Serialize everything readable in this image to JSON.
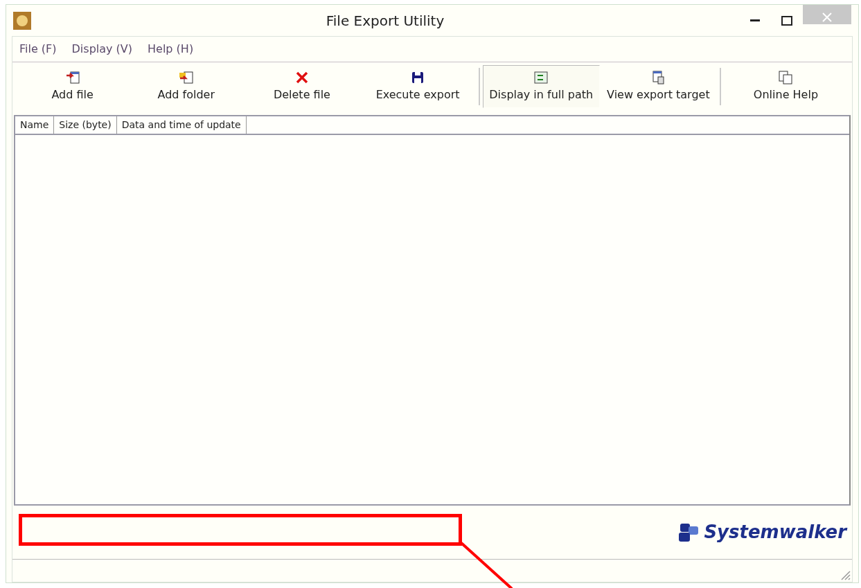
{
  "window": {
    "title": "File Export Utility"
  },
  "menu": [
    "File (F)",
    "Display (V)",
    "Help (H)"
  ],
  "toolbar": [
    {
      "label": "Add file",
      "kind": "add-file",
      "pressed": false
    },
    {
      "label": "Add folder",
      "kind": "add-folder",
      "pressed": false
    },
    {
      "label": "Delete file",
      "kind": "delete",
      "pressed": false
    },
    {
      "label": "Execute export",
      "kind": "save",
      "pressed": false
    },
    {
      "label": "Display in full path",
      "kind": "full-path",
      "pressed": true
    },
    {
      "label": "View export target",
      "kind": "view-target",
      "pressed": false
    },
    {
      "label": "Online Help",
      "kind": "help",
      "pressed": false
    }
  ],
  "table": {
    "columns": [
      "Name",
      "Size (byte)",
      "Data and time of update"
    ]
  },
  "logo": {
    "text": "Systemwalker"
  }
}
